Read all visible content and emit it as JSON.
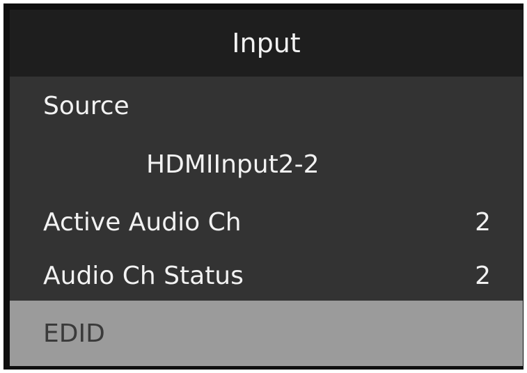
{
  "menu": {
    "title": "Input",
    "items": [
      {
        "label": "Source",
        "value": ""
      },
      {
        "label": "HDMIInput2-2",
        "value": ""
      },
      {
        "label": "Active Audio Ch",
        "value": "2"
      },
      {
        "label": "Audio Ch Status",
        "value": "2"
      },
      {
        "label": "EDID",
        "value": ""
      }
    ],
    "selected_index": 4,
    "colors": {
      "frame": "#0f0f0f",
      "header_bg": "#1e1e1e",
      "body_bg": "#333333",
      "selected_bg": "#9b9b9b",
      "text": "#f2f2f2",
      "selected_text": "#3a3a3a"
    }
  }
}
